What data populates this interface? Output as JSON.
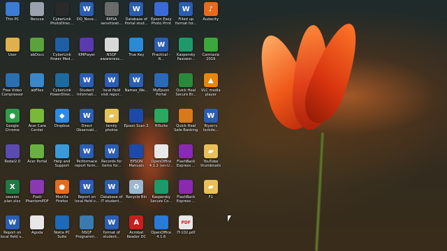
{
  "desktop": {
    "icons": [
      {
        "label": "This PC",
        "icon": "computer-icon",
        "color": "#3a7bd5"
      },
      {
        "label": "User",
        "icon": "user-folder-icon",
        "color": "#e0b04a"
      },
      {
        "label": "Free Video Compressor",
        "icon": "video-compressor-icon",
        "color": "#2a6fb0"
      },
      {
        "label": "Google Chrome",
        "icon": "chrome-icon",
        "color": "#2e9d48"
      },
      {
        "label": "Rodal2.0",
        "icon": "app-icon",
        "color": "#5a4bb0"
      },
      {
        "label": "session plan.xlsx",
        "icon": "excel-icon",
        "color": "#1d7a45"
      },
      {
        "label": "Report on local field v...",
        "icon": "word-icon",
        "color": "#2b5db3"
      },
      {
        "label": "Recuva",
        "icon": "recuva-icon",
        "color": "#9aa3ad"
      },
      {
        "label": "abDocs",
        "icon": "abdocs-icon",
        "color": "#5aa33a"
      },
      {
        "label": "abFiles",
        "icon": "abfiles-icon",
        "color": "#3a86c8"
      },
      {
        "label": "Acer Care Center",
        "icon": "acer-care-icon",
        "color": "#7ab83a"
      },
      {
        "label": "Acer Portal",
        "icon": "acer-portal-icon",
        "color": "#6ab040"
      },
      {
        "label": "Foxit PhantomPDF",
        "icon": "foxit-icon",
        "color": "#8a3ab0"
      },
      {
        "label": "Agoda",
        "icon": "agoda-icon",
        "color": "#e8e8e8"
      },
      {
        "label": "CyberLink PhotoDirec...",
        "icon": "photodirector-icon",
        "color": "#2a2a2a"
      },
      {
        "label": "CyberLink Power Med...",
        "icon": "powermedia-icon",
        "color": "#1f5fa8"
      },
      {
        "label": "CyberLink PowerDirec...",
        "icon": "powerdirector-icon",
        "color": "#1d6aa0"
      },
      {
        "label": "Dropbox",
        "icon": "dropbox-icon",
        "color": "#2d8ae6"
      },
      {
        "label": "Help and Support",
        "icon": "help-icon",
        "color": "#3a9ad9"
      },
      {
        "label": "Mozilla Firefox",
        "icon": "firefox-icon",
        "color": "#e66b1a"
      },
      {
        "label": "Nokia PC Suite",
        "icon": "nokia-icon",
        "color": "#1d6ab8"
      },
      {
        "label": "DQ_Nove...",
        "icon": "word-doc-icon",
        "color": "#2b5db3"
      },
      {
        "label": "KMPlayer",
        "icon": "kmplayer-icon",
        "color": "#5a3ab0"
      },
      {
        "label": "Student Informati...",
        "icon": "word-doc-icon",
        "color": "#2b5db3"
      },
      {
        "label": "Direct Observati...",
        "icon": "word-doc-icon",
        "color": "#2b5db3"
      },
      {
        "label": "Performace report form...",
        "icon": "word-doc-icon",
        "color": "#2b5db3"
      },
      {
        "label": "Report on local field v...",
        "icon": "word-doc-icon",
        "color": "#2b5db3"
      },
      {
        "label": "NSQF Programm...",
        "icon": "nsqf-icon",
        "color": "#3a7ab0"
      },
      {
        "label": "RMSA sensitizati...",
        "icon": "file-icon",
        "color": "#6a6a6a"
      },
      {
        "label": "NSQF awareness...",
        "icon": "file-icon",
        "color": "#d8d8d8"
      },
      {
        "label": "local field visit repor...",
        "icon": "word-doc-icon",
        "color": "#2b5db3"
      },
      {
        "label": "family photos",
        "icon": "folder-icon",
        "color": "#e8c05a"
      },
      {
        "label": "Records for items for...",
        "icon": "word-doc-icon",
        "color": "#2b5db3"
      },
      {
        "label": "Database of IT student...",
        "icon": "word-doc-icon",
        "color": "#2b5db3"
      },
      {
        "label": "format of student...",
        "icon": "word-doc-icon",
        "color": "#2b5db3"
      },
      {
        "label": "Database of Portal stud...",
        "icon": "word-doc-icon",
        "color": "#2b5db3"
      },
      {
        "label": "True Key",
        "icon": "truekey-icon",
        "color": "#2a8ad8"
      },
      {
        "label": "Names_We...",
        "icon": "word-doc-icon",
        "color": "#2b5db3"
      },
      {
        "label": "Epson Scan 2",
        "icon": "epson-scan-icon",
        "color": "#1d4aa8"
      },
      {
        "label": "EPSON Manuals",
        "icon": "epson-manuals-icon",
        "color": "#1d4aa8"
      },
      {
        "label": "Recycle Bin",
        "icon": "recycle-bin-icon",
        "color": "#9ab8d0"
      },
      {
        "label": "Acrobat Reader DC",
        "icon": "acrobat-icon",
        "color": "#c81e1e"
      },
      {
        "label": "Epson Easy Photo Print",
        "icon": "epson-photo-icon",
        "color": "#3a6ad8"
      },
      {
        "label": "Practical - R...",
        "icon": "word-doc-icon",
        "color": "#2b5db3"
      },
      {
        "label": "MyEpson Portal",
        "icon": "myepson-icon",
        "color": "#2a6ab8"
      },
      {
        "label": "HiSuite",
        "icon": "hisuite-icon",
        "color": "#2aa860"
      },
      {
        "label": "OpenOffice 4.1.2 (en-U...",
        "icon": "openoffice-icon",
        "color": "#e8e8e8"
      },
      {
        "label": "Kaspersky Secure Co...",
        "icon": "kaspersky-icon",
        "color": "#1d9a6a"
      },
      {
        "label": "OpenOffice 4.1.6",
        "icon": "openoffice-icon",
        "color": "#2a7ad8"
      },
      {
        "label": "Filled up format for...",
        "icon": "word-doc-icon",
        "color": "#2b5db3"
      },
      {
        "label": "Kaspersky Passwor...",
        "icon": "kaspersky-password-icon",
        "color": "#1d9a6a"
      },
      {
        "label": "Quick Heal Secure Br...",
        "icon": "quickheal-icon",
        "color": "#2a8a3a"
      },
      {
        "label": "Quick Heal Safe Banking",
        "icon": "quickheal-banking-icon",
        "color": "#d87a1a"
      },
      {
        "label": "FlashBack Express ...",
        "icon": "flashback-icon",
        "color": "#8a2ab0"
      },
      {
        "label": "FlashBack Express ...",
        "icon": "flashback-icon",
        "color": "#8a2ab0"
      },
      {
        "label": "IT-102.pdf",
        "icon": "pdf-icon",
        "color": "#e8e8e8"
      },
      {
        "label": "Audacity",
        "icon": "audacity-icon",
        "color": "#e86a1a"
      },
      {
        "label": "Camtasia 2019",
        "icon": "camtasia-icon",
        "color": "#3aa83a"
      },
      {
        "label": "VLC media player",
        "icon": "vlc-icon",
        "color": "#e8860a"
      },
      {
        "label": "Riyan's lockdo...",
        "icon": "word-doc-icon",
        "color": "#2b5db3"
      },
      {
        "label": "YouTube thumbnails",
        "icon": "folder-icon",
        "color": "#e8c05a"
      },
      {
        "label": "F1",
        "icon": "folder-icon",
        "color": "#e8c05a"
      }
    ]
  }
}
